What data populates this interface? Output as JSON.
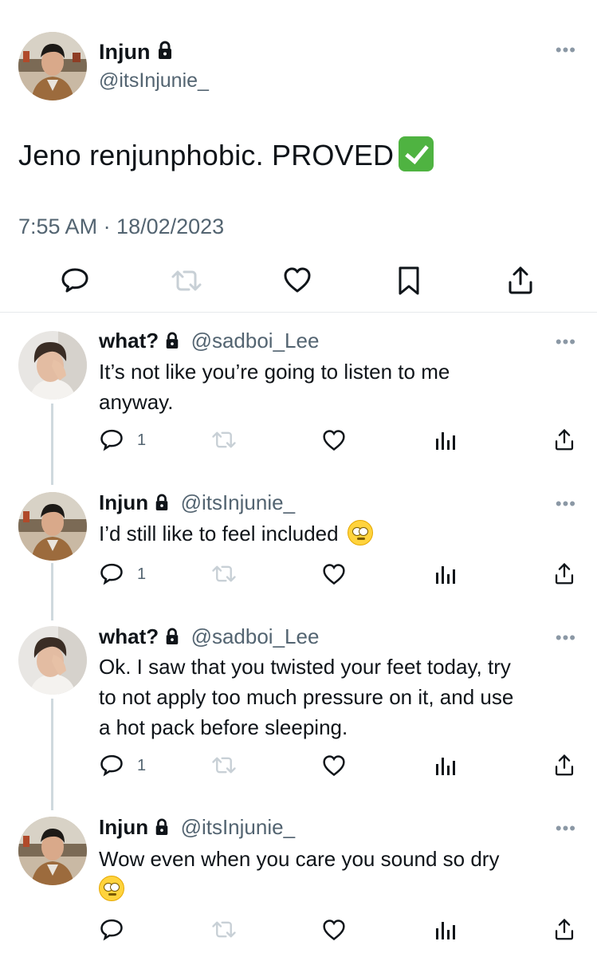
{
  "main_tweet": {
    "name": "Injun",
    "handle": "@itsInjunie_",
    "text": "Jeno renjunphobic. PROVED",
    "emoji": "check-mark-emoji",
    "timestamp": "7:55 AM · 18/02/2023"
  },
  "replies": [
    {
      "name": "what?",
      "handle": "@sadboi_Lee",
      "text_line1": "It’s not like you’re going to listen to me",
      "text_line2": "anyway.",
      "reply_count": "1"
    },
    {
      "name": "Injun",
      "handle": "@itsInjunie_",
      "text_line1": "I’d still like to feel included",
      "emoji": "face-with-rolling-eyes-emoji",
      "reply_count": "1"
    },
    {
      "name": "what?",
      "handle": "@sadboi_Lee",
      "text_line1": "Ok. I saw that you twisted your feet today, try",
      "text_line2": "to not apply too much pressure on it, and use",
      "text_line3": "a hot pack before sleeping.",
      "reply_count": "1"
    },
    {
      "name": "Injun",
      "handle": "@itsInjunie_",
      "text_line1": "Wow even when you care you sound so dry",
      "emoji": "face-with-rolling-eyes-emoji",
      "reply_count": ""
    }
  ],
  "more_label": "•••",
  "colors": {
    "text": "#0f1419",
    "muted": "#536471",
    "thread_line": "#cfd9de"
  }
}
